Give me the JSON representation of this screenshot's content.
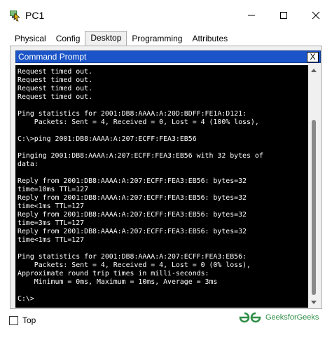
{
  "window": {
    "title": "PC1"
  },
  "tabs": [
    {
      "label": "Physical",
      "active": false
    },
    {
      "label": "Config",
      "active": false
    },
    {
      "label": "Desktop",
      "active": true
    },
    {
      "label": "Programming",
      "active": false
    },
    {
      "label": "Attributes",
      "active": false
    }
  ],
  "command_prompt": {
    "title": "Command Prompt",
    "close_label": "X",
    "output": "Request timed out.\nRequest timed out.\nRequest timed out.\nRequest timed out.\n\nPing statistics for 2001:DB8:AAAA:A:20D:BDFF:FE1A:D121:\n    Packets: Sent = 4, Received = 0, Lost = 4 (100% loss),\n\nC:\\>ping 2001:DB8:AAAA:A:207:ECFF:FEA3:EB56\n\nPinging 2001:DB8:AAAA:A:207:ECFF:FEA3:EB56 with 32 bytes of\ndata:\n\nReply from 2001:DB8:AAAA:A:207:ECFF:FEA3:EB56: bytes=32\ntime=10ms TTL=127\nReply from 2001:DB8:AAAA:A:207:ECFF:FEA3:EB56: bytes=32\ntime<1ms TTL=127\nReply from 2001:DB8:AAAA:A:207:ECFF:FEA3:EB56: bytes=32\ntime=3ms TTL=127\nReply from 2001:DB8:AAAA:A:207:ECFF:FEA3:EB56: bytes=32\ntime<1ms TTL=127\n\nPing statistics for 2001:DB8:AAAA:A:207:ECFF:FEA3:EB56:\n    Packets: Sent = 4, Received = 4, Lost = 0 (0% loss),\nApproximate round trip times in milli-seconds:\n    Minimum = 0ms, Maximum = 10ms, Average = 3ms\n\nC:\\>"
  },
  "footer": {
    "top_label": "Top",
    "top_checked": false,
    "watermark": "GeeksforGeeks"
  },
  "colors": {
    "cmd_title_bg": "#1a54c8",
    "terminal_bg": "#000000",
    "terminal_fg": "#ffffff",
    "brand_green": "#2f8d46"
  },
  "icons": {
    "app": "packet-tracer-pc-icon",
    "minimize": "minimize-icon",
    "maximize": "maximize-icon",
    "close": "close-icon",
    "logo": "geeksforgeeks-logo"
  }
}
